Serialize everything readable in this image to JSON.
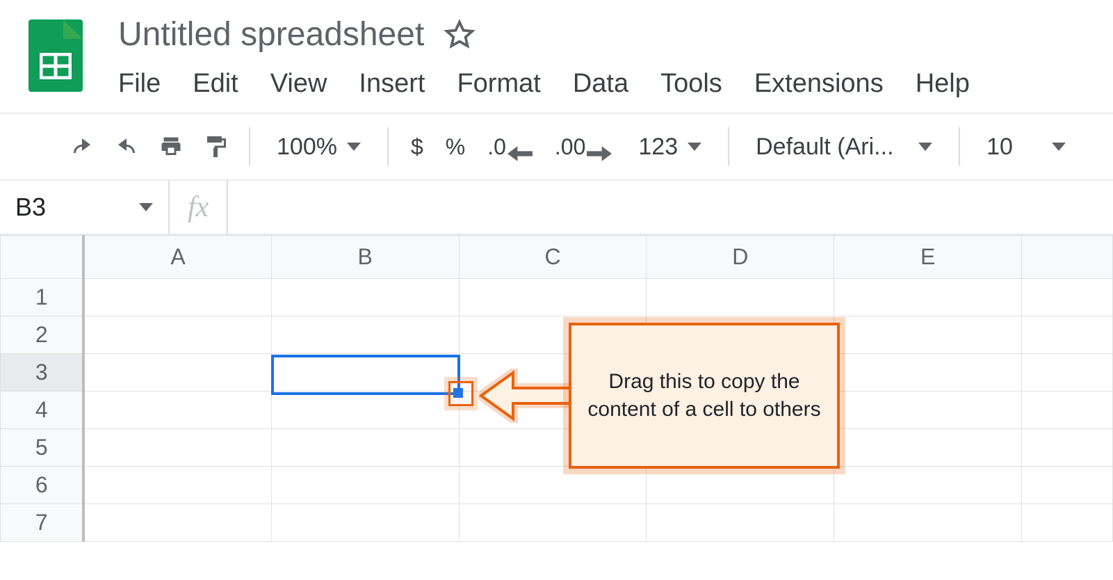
{
  "doc": {
    "title": "Untitled spreadsheet"
  },
  "menu": {
    "file": "File",
    "edit": "Edit",
    "view": "View",
    "insert": "Insert",
    "format": "Format",
    "data": "Data",
    "tools": "Tools",
    "extensions": "Extensions",
    "help": "Help"
  },
  "toolbar": {
    "zoom": "100%",
    "currency": "$",
    "percent": "%",
    "dec_less": ".0",
    "dec_more": ".00",
    "more_formats": "123",
    "font": "Default (Ari...",
    "font_size": "10"
  },
  "formula_bar": {
    "cell_ref": "B3",
    "fx_label": "fx",
    "value": ""
  },
  "grid": {
    "columns": [
      "A",
      "B",
      "C",
      "D",
      "E"
    ],
    "rows": [
      "1",
      "2",
      "3",
      "4",
      "5",
      "6",
      "7"
    ],
    "selected_cell": "B3"
  },
  "annotation": {
    "text": "Drag this to copy the content of a cell to others"
  }
}
